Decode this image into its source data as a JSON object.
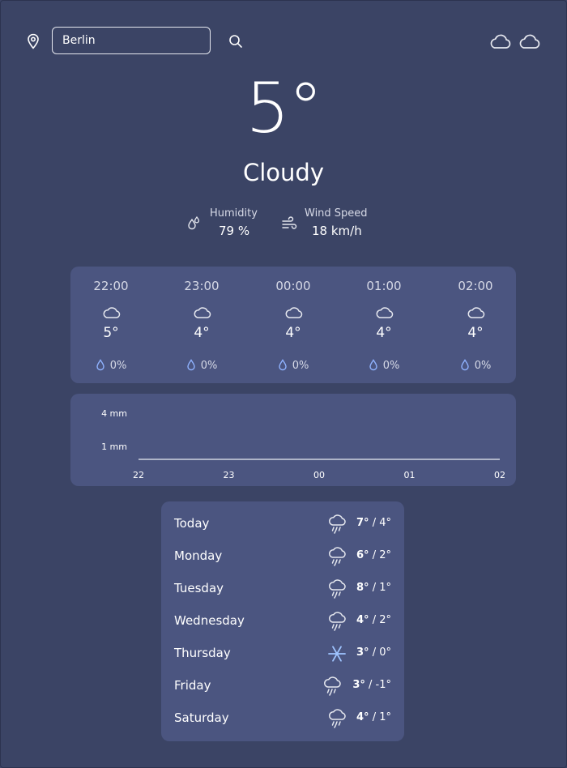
{
  "search": {
    "value": "Berlin",
    "placeholder": ""
  },
  "current": {
    "temperature": "5°",
    "condition": "Cloudy",
    "humidity_label": "Humidity",
    "humidity_value": "79 %",
    "wind_label": "Wind Speed",
    "wind_value": "18 km/h"
  },
  "hourly": [
    {
      "time": "22:00",
      "temp": "5°",
      "precip": "0%",
      "icon": "cloud-icon"
    },
    {
      "time": "23:00",
      "temp": "4°",
      "precip": "0%",
      "icon": "cloud-icon"
    },
    {
      "time": "00:00",
      "temp": "4°",
      "precip": "0%",
      "icon": "cloud-icon"
    },
    {
      "time": "01:00",
      "temp": "4°",
      "precip": "0%",
      "icon": "cloud-icon"
    },
    {
      "time": "02:00",
      "temp": "4°",
      "precip": "0%",
      "icon": "cloud-icon"
    }
  ],
  "chart_data": {
    "type": "line",
    "x": [
      "22",
      "23",
      "00",
      "01",
      "02"
    ],
    "series": [
      {
        "values": [
          0,
          0,
          0,
          0,
          0
        ]
      }
    ],
    "y_ticks": [
      "4 mm",
      "1 mm"
    ],
    "grid": false
  },
  "daily": [
    {
      "day": "Today",
      "high": "7°",
      "low": "4°",
      "icon": "cloud-rain-icon"
    },
    {
      "day": "Monday",
      "high": "6°",
      "low": "2°",
      "icon": "cloud-rain-icon"
    },
    {
      "day": "Tuesday",
      "high": "8°",
      "low": "1°",
      "icon": "cloud-rain-icon"
    },
    {
      "day": "Wednesday",
      "high": "4°",
      "low": "2°",
      "icon": "cloud-rain-icon"
    },
    {
      "day": "Thursday",
      "high": "3°",
      "low": "0°",
      "icon": "snowflake-icon"
    },
    {
      "day": "Friday",
      "high": "3°",
      "low": "-1°",
      "icon": "cloud-rain-icon"
    },
    {
      "day": "Saturday",
      "high": "4°",
      "low": "1°",
      "icon": "cloud-rain-icon"
    }
  ],
  "colors": {
    "background": "#3b4465",
    "card": "#4b5580",
    "drop": "#8fb2ff",
    "snow": "#9fc4ff"
  }
}
